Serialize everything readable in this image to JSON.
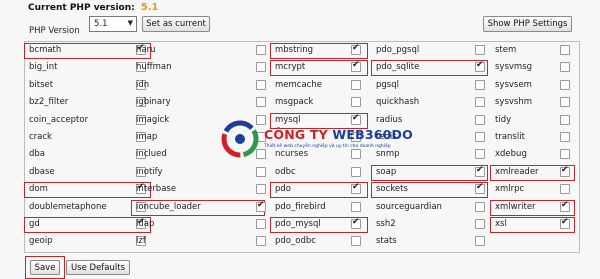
{
  "header": {
    "title": "Current PHP version:",
    "version": "5.1"
  },
  "controls": {
    "php_version_label": "PHP Version",
    "php_version_value": "5.1",
    "set_current_label": "Set as current",
    "show_settings_label": "Show PHP Settings"
  },
  "extensions": {
    "col1": [
      {
        "name": "bcmath",
        "checked": true,
        "highlighted": true
      },
      {
        "name": "big_int",
        "checked": false,
        "highlighted": false
      },
      {
        "name": "bitset",
        "checked": false,
        "highlighted": false
      },
      {
        "name": "bz2_filter",
        "checked": false,
        "highlighted": false
      },
      {
        "name": "coin_acceptor",
        "checked": false,
        "highlighted": false
      },
      {
        "name": "crack",
        "checked": false,
        "highlighted": false
      },
      {
        "name": "dba",
        "checked": false,
        "highlighted": false
      },
      {
        "name": "dbase",
        "checked": false,
        "highlighted": false
      },
      {
        "name": "dom",
        "checked": true,
        "highlighted": true
      },
      {
        "name": "doublemetaphone",
        "checked": false,
        "highlighted": false
      },
      {
        "name": "gd",
        "checked": true,
        "highlighted": true
      },
      {
        "name": "geoip",
        "checked": false,
        "highlighted": false
      }
    ],
    "col2": [
      {
        "name": "haru",
        "checked": false,
        "highlighted": false
      },
      {
        "name": "huffman",
        "checked": false,
        "highlighted": false
      },
      {
        "name": "idn",
        "checked": false,
        "highlighted": false
      },
      {
        "name": "igbinary",
        "checked": false,
        "highlighted": false
      },
      {
        "name": "imagick",
        "checked": false,
        "highlighted": false
      },
      {
        "name": "imap",
        "checked": false,
        "highlighted": false
      },
      {
        "name": "inclued",
        "checked": false,
        "highlighted": false
      },
      {
        "name": "inotify",
        "checked": false,
        "highlighted": false
      },
      {
        "name": "interbase",
        "checked": false,
        "highlighted": false
      },
      {
        "name": "ioncube_loader",
        "checked": true,
        "highlighted": true
      },
      {
        "name": "ldap",
        "checked": false,
        "highlighted": false
      },
      {
        "name": "lzf",
        "checked": false,
        "highlighted": false
      }
    ],
    "col3": [
      {
        "name": "mbstring",
        "checked": true,
        "highlighted": true
      },
      {
        "name": "mcrypt",
        "checked": true,
        "highlighted": true
      },
      {
        "name": "memcache",
        "checked": false,
        "highlighted": false
      },
      {
        "name": "msgpack",
        "checked": false,
        "highlighted": false
      },
      {
        "name": "mysql",
        "checked": true,
        "highlighted": true
      },
      {
        "name": "",
        "checked": false,
        "highlighted": false
      },
      {
        "name": "ncurses",
        "checked": false,
        "highlighted": false
      },
      {
        "name": "odbc",
        "checked": false,
        "highlighted": false
      },
      {
        "name": "pdo",
        "checked": true,
        "highlighted": true
      },
      {
        "name": "pdo_firebird",
        "checked": false,
        "highlighted": false
      },
      {
        "name": "pdo_mysql",
        "checked": true,
        "highlighted": true
      },
      {
        "name": "pdo_odbc",
        "checked": false,
        "highlighted": false
      }
    ],
    "col4": [
      {
        "name": "pdo_pgsql",
        "checked": false,
        "highlighted": false
      },
      {
        "name": "pdo_sqlite",
        "checked": true,
        "highlighted": true
      },
      {
        "name": "pgsql",
        "checked": false,
        "highlighted": false
      },
      {
        "name": "quickhash",
        "checked": false,
        "highlighted": false
      },
      {
        "name": "radius",
        "checked": false,
        "highlighted": false
      },
      {
        "name": "redis",
        "checked": false,
        "highlighted": false
      },
      {
        "name": "snmp",
        "checked": false,
        "highlighted": false
      },
      {
        "name": "soap",
        "checked": true,
        "highlighted": true
      },
      {
        "name": "sockets",
        "checked": true,
        "highlighted": true
      },
      {
        "name": "sourceguardian",
        "checked": false,
        "highlighted": false
      },
      {
        "name": "ssh2",
        "checked": false,
        "highlighted": false
      },
      {
        "name": "stats",
        "checked": false,
        "highlighted": false
      }
    ],
    "col5": [
      {
        "name": "stem",
        "checked": false,
        "highlighted": false
      },
      {
        "name": "sysvmsg",
        "checked": false,
        "highlighted": false
      },
      {
        "name": "sysvsem",
        "checked": false,
        "highlighted": false
      },
      {
        "name": "sysvshm",
        "checked": false,
        "highlighted": false
      },
      {
        "name": "tidy",
        "checked": false,
        "highlighted": false
      },
      {
        "name": "translit",
        "checked": false,
        "highlighted": false
      },
      {
        "name": "xdebug",
        "checked": false,
        "highlighted": false
      },
      {
        "name": "xmlreader",
        "checked": true,
        "highlighted": true
      },
      {
        "name": "xmlrpc",
        "checked": false,
        "highlighted": false
      },
      {
        "name": "xmlwriter",
        "checked": true,
        "highlighted": true
      },
      {
        "name": "xsl",
        "checked": true,
        "highlighted": true
      },
      {
        "name": "",
        "checked": false,
        "highlighted": false
      }
    ]
  },
  "footer": {
    "save_label": "Save",
    "defaults_label": "Use Defaults"
  },
  "watermark": {
    "brand_part1": "CÔNG TY ",
    "brand_part2": "WEB360DO",
    "tagline": "Thiết kế web chuyên nghiệp và uy tín cho doanh nghiệp"
  },
  "colors": {
    "highlight": "#c0262d",
    "version": "#e29a1c",
    "brand_blue": "#1b3e9a",
    "brand_red": "#d01f26"
  }
}
